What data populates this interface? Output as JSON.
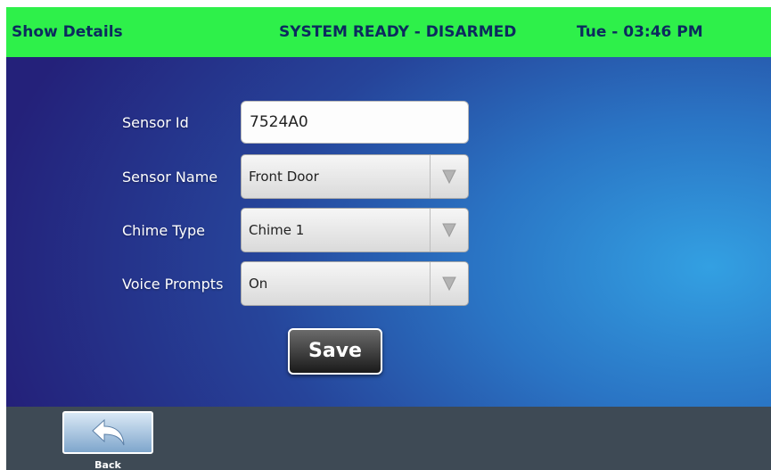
{
  "topbar": {
    "left": "Show Details",
    "status": "SYSTEM READY - DISARMED",
    "datetime": "Tue - 03:46 PM",
    "color": "#2ef04a"
  },
  "form": {
    "sensor_id": {
      "label": "Sensor Id",
      "value": "7524A0"
    },
    "sensor_name": {
      "label": "Sensor Name",
      "value": "Front Door"
    },
    "chime_type": {
      "label": "Chime Type",
      "value": "Chime 1"
    },
    "voice_prompts": {
      "label": "Voice Prompts",
      "value": "On"
    },
    "save_label": "Save"
  },
  "footer": {
    "back_label": "Back",
    "back_icon": "back-arrow-icon"
  }
}
